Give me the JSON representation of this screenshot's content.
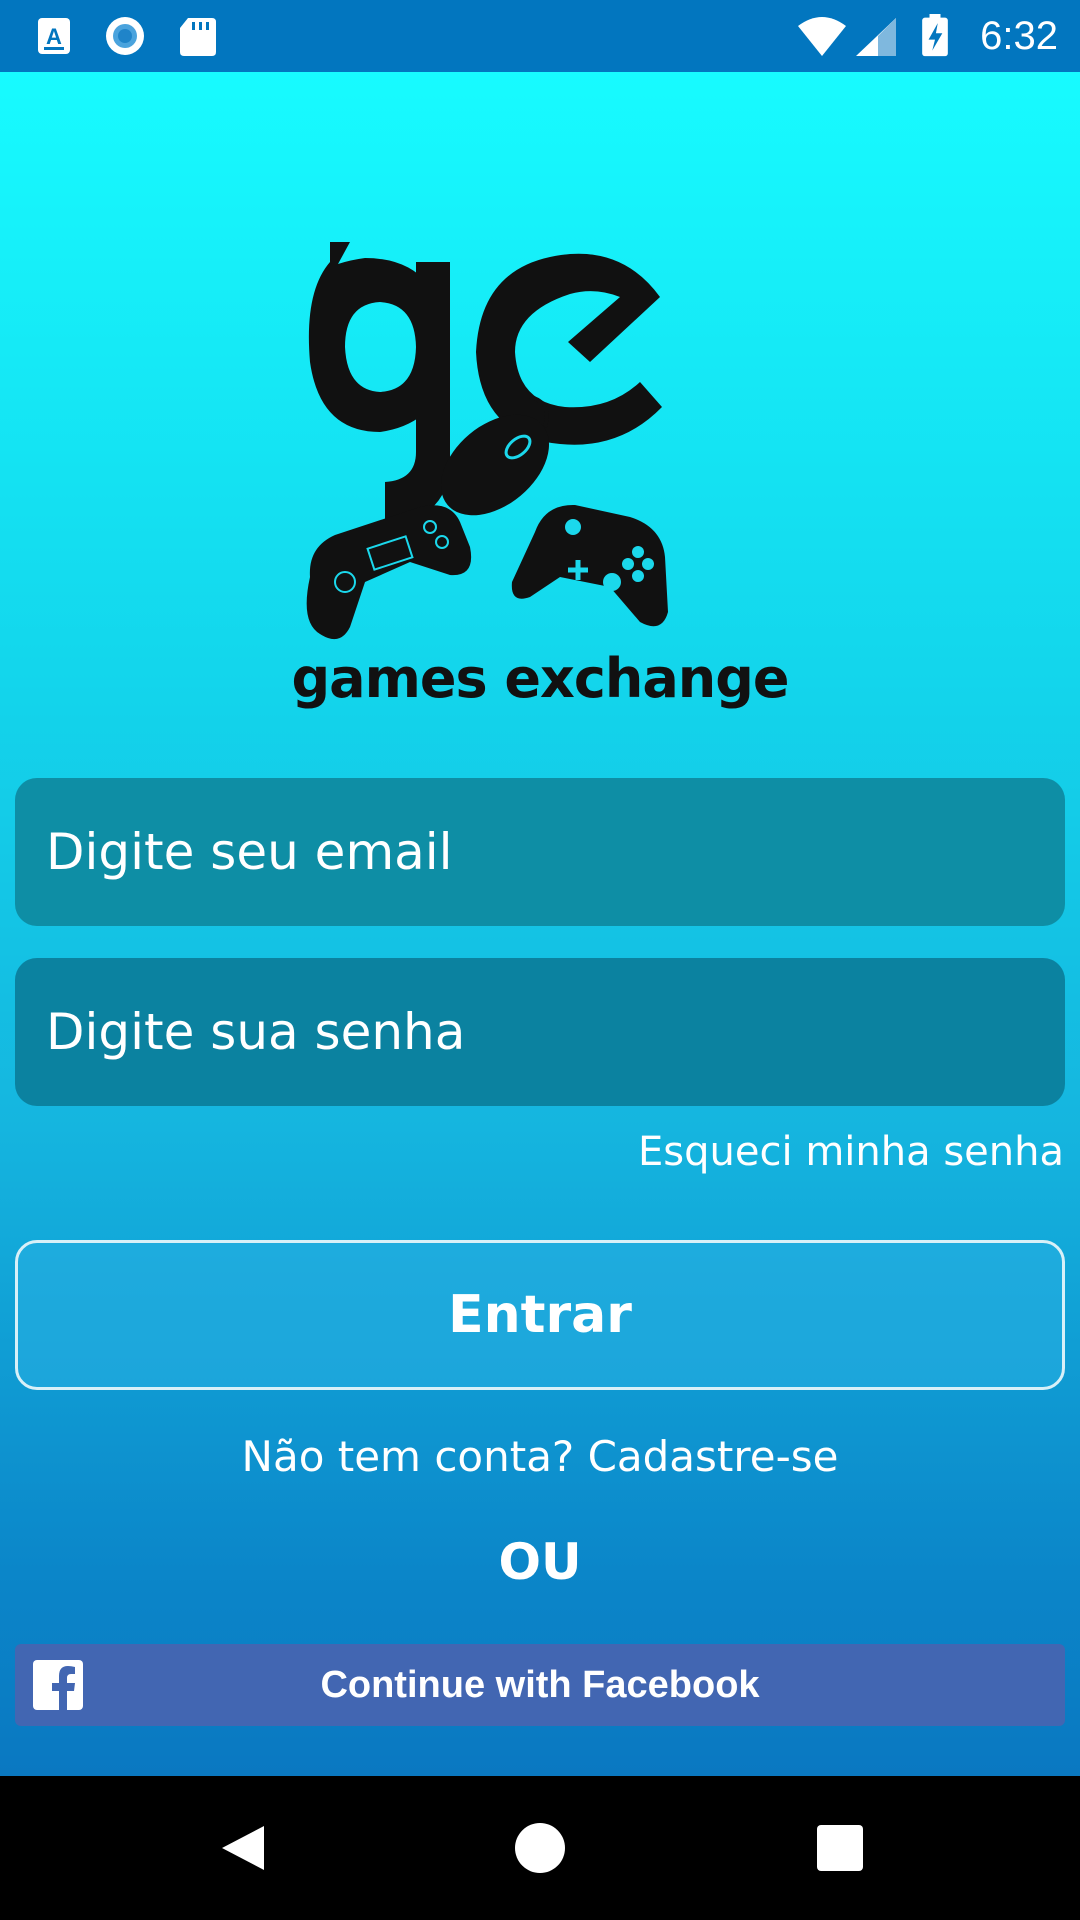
{
  "status_bar": {
    "time": "6:32",
    "left_icons": [
      "text-notification-icon",
      "record-icon",
      "sd-card-icon"
    ],
    "right_icons": [
      "wifi-icon",
      "signal-icon",
      "battery-charging-icon"
    ]
  },
  "logo": {
    "monogram": "ge",
    "wordmark": "games exchange"
  },
  "login_form": {
    "email_placeholder": "Digite seu email",
    "password_placeholder": "Digite sua senha",
    "forgot_password": "Esqueci minha senha",
    "login_button": "Entrar",
    "signup_prompt": "Não tem conta? Cadastre-se",
    "or_separator": "OU",
    "facebook_button": "Continue with Facebook"
  },
  "navigation": {
    "buttons": [
      "back-icon",
      "home-icon",
      "recents-icon"
    ]
  },
  "colors": {
    "status_bar": "#0276bf",
    "background_top": "#17fbff",
    "background_bottom": "#0a78c1",
    "input_fill": "#0e8ea5",
    "facebook": "#4266b2"
  }
}
